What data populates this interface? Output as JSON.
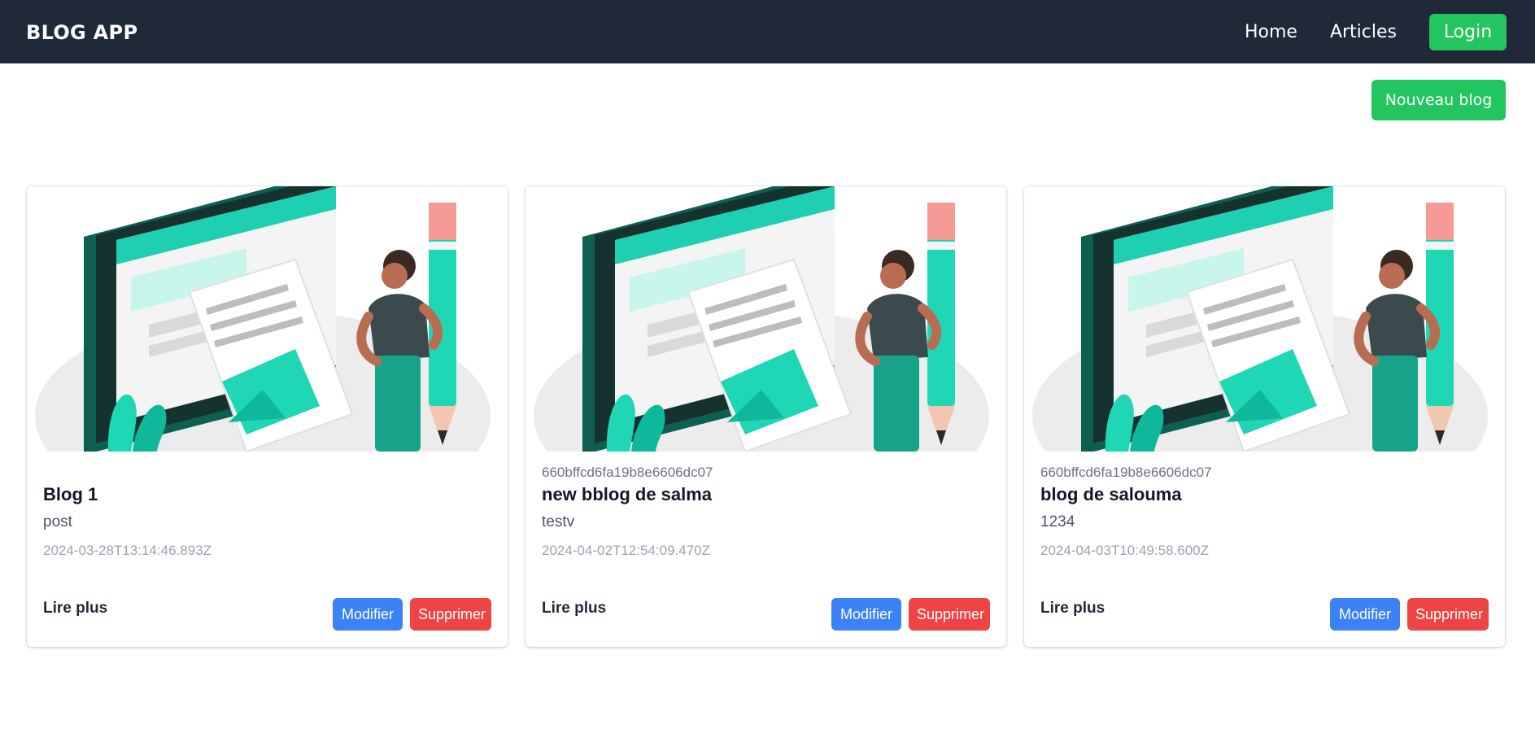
{
  "app": {
    "brand": "BLOG APP"
  },
  "nav": {
    "home": "Home",
    "articles": "Articles",
    "login": "Login"
  },
  "actions": {
    "new_blog": "Nouveau blog"
  },
  "colors": {
    "navbar": "#1f2937",
    "primary_green": "#22c55e",
    "edit_blue": "#3b82f6",
    "delete_red": "#ef4444"
  },
  "cards": [
    {
      "id": "",
      "title": "Blog 1",
      "content": "post",
      "date": "2024-03-28T13:14:46.893Z",
      "read_more": "Lire plus",
      "edit": "Modifier",
      "delete": "Supprimer",
      "image": "blog-illustration-icon"
    },
    {
      "id": "660bffcd6fa19b8e6606dc07",
      "title": "new bblog de salma",
      "content": "testv",
      "date": "2024-04-02T12:54:09.470Z",
      "read_more": "Lire plus",
      "edit": "Modifier",
      "delete": "Supprimer",
      "image": "blog-illustration-icon"
    },
    {
      "id": "660bffcd6fa19b8e6606dc07",
      "title": "blog de salouma",
      "content": "1234",
      "date": "2024-04-03T10:49:58.600Z",
      "read_more": "Lire plus",
      "edit": "Modifier",
      "delete": "Supprimer",
      "image": "blog-illustration-icon"
    }
  ]
}
